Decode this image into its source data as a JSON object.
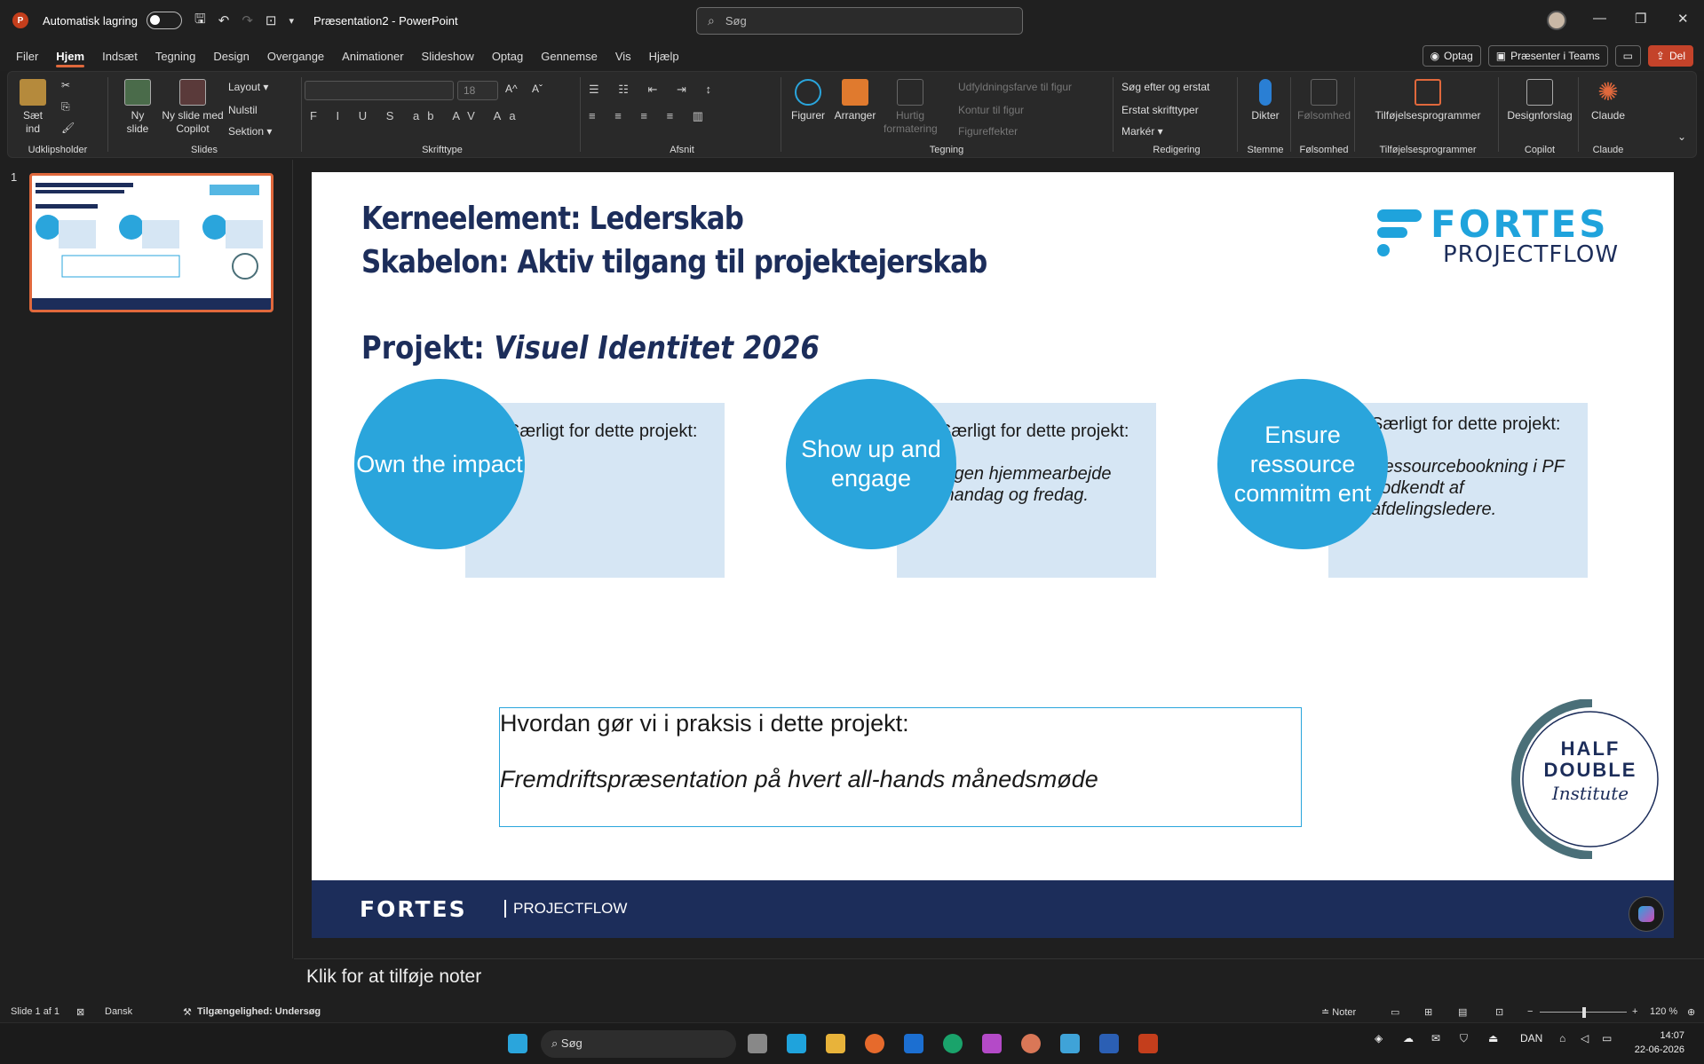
{
  "titlebar": {
    "app_icon_letter": "P",
    "autosave_label": "Automatisk lagring",
    "doc_title": "Præsentation2 - PowerPoint",
    "search_placeholder": "Søg"
  },
  "menu": {
    "items": [
      "Filer",
      "Hjem",
      "Indsæt",
      "Tegning",
      "Design",
      "Overgange",
      "Animationer",
      "Slideshow",
      "Optag",
      "Gennemse",
      "Vis",
      "Hjælp"
    ],
    "active": "Hjem",
    "record_btn": "Optag",
    "teams_btn": "Præsenter i Teams",
    "share_btn": "Del"
  },
  "ribbon": {
    "paste": "Sæt ind",
    "clipboard_group": "Udklipsholder",
    "new_slide": "Ny slide",
    "new_slide_copilot": "Ny slide med Copilot",
    "layout": "Layout",
    "reset": "Nulstil",
    "section": "Sektion",
    "slides_group": "Slides",
    "font_size": "18",
    "font_group": "Skrifttype",
    "paragraph_group": "Afsnit",
    "shapes": "Figurer",
    "arrange": "Arranger",
    "quick_styles": "Hurtig formatering",
    "shape_fill": "Udfyldningsfarve til figur",
    "shape_outline": "Kontur til figur",
    "shape_effects": "Figureffekter",
    "drawing_group": "Tegning",
    "find_replace": "Søg efter og erstat",
    "replace_fonts": "Erstat skrifttyper",
    "select": "Markér",
    "editing_group": "Redigering",
    "dictate": "Dikter",
    "voice_group": "Stemme",
    "sensitivity": "Følsomhed",
    "sensitivity_group": "Følsomhed",
    "addins": "Tilføjelsesprogrammer",
    "addins_group": "Tilføjelsesprogrammer",
    "designer": "Designforslag",
    "copilot_group": "Copilot",
    "claude": "Claude",
    "claude_group": "Claude"
  },
  "thumbnail": {
    "number": "1"
  },
  "slide": {
    "title_line1": "Kerneelement: Lederskab",
    "title_line2": "Skabelon: Aktiv tilgang til projektejerskab",
    "project_label": "Projekt:",
    "project_name": "Visuel Identitet 2026",
    "logo_word1": "FORTES",
    "logo_word2": "PROJECTFLOW",
    "pillars": [
      {
        "circle": "Own the impact",
        "lead": "Særligt for dette projekt:",
        "detail": "-"
      },
      {
        "circle": "Show up and engage",
        "lead": "Særligt for dette projekt:",
        "detail": "Ingen hjemmearbejde mandag og fredag."
      },
      {
        "circle": "Ensure ressource commitm ent",
        "lead": "Særligt for dette projekt:",
        "detail": "Ressourcebookning i PF godkendt af afdelingsledere."
      }
    ],
    "praksis_question": "Hvordan gør vi i praksis i dette projekt:",
    "praksis_answer": "Fremdriftspræsentation på hvert all-hands månedsmøde",
    "half_double_line1": "HALF",
    "half_double_line2": "DOUBLE",
    "half_double_line3": "Institute",
    "footer_word1": "FORTES",
    "footer_word2": "PROJECTFLOW"
  },
  "notes_placeholder": "Klik for at tilføje noter",
  "status": {
    "slide_info": "Slide 1 af 1",
    "language": "Dansk",
    "accessibility": "Tilgængelighed: Undersøg",
    "notes": "Noter",
    "zoom": "120 %"
  },
  "taskbar": {
    "search": "Søg",
    "lang": "DAN",
    "time": "14:07",
    "date": "22-06-2026"
  },
  "colors": {
    "accent": "#2aa5dc",
    "navy": "#1c2d5a",
    "note_bg": "#d6e6f4",
    "ppt_orange": "#c43e1c"
  }
}
